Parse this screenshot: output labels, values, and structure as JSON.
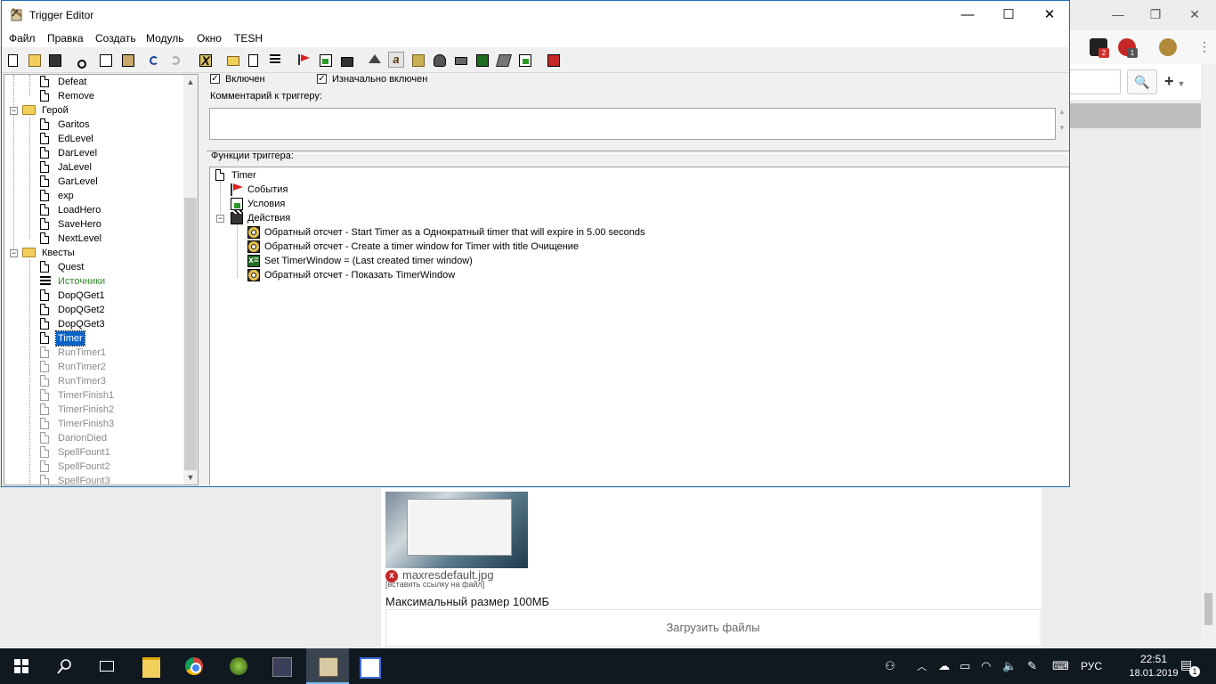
{
  "window": {
    "title": "Trigger Editor",
    "controls": {
      "minimize": "—",
      "maximize": "☐",
      "close": "✕"
    }
  },
  "menu": [
    "Файл",
    "Правка",
    "Создать",
    "Модуль",
    "Окно",
    "TESH"
  ],
  "toolbar": {
    "icons": [
      "new-icon",
      "open-icon",
      "save-icon",
      "cut-icon",
      "copy-icon",
      "paste-icon",
      "undo-icon",
      "redo-icon",
      "jass-icon",
      "new-category-icon",
      "new-trigger-icon",
      "new-comment-icon",
      "new-event-icon",
      "new-condition-icon",
      "new-action-icon",
      "terrain-editor-icon",
      "trigger-editor-icon",
      "sound-editor-icon",
      "object-editor-icon",
      "campaign-editor-icon",
      "ai-editor-icon",
      "object-manager-icon",
      "import-manager-icon",
      "test-map-icon"
    ]
  },
  "tree": {
    "items": [
      {
        "label": "Defeat",
        "type": "trigger",
        "level": 2,
        "state": "normal"
      },
      {
        "label": "Remove",
        "type": "trigger",
        "level": 2,
        "state": "normal"
      },
      {
        "label": "Герой",
        "type": "folder",
        "level": 1,
        "state": "normal"
      },
      {
        "label": "Garitos",
        "type": "trigger",
        "level": 2,
        "state": "normal"
      },
      {
        "label": "EdLevel",
        "type": "trigger",
        "level": 2,
        "state": "normal"
      },
      {
        "label": "DarLevel",
        "type": "trigger",
        "level": 2,
        "state": "normal"
      },
      {
        "label": "JaLevel",
        "type": "trigger",
        "level": 2,
        "state": "normal"
      },
      {
        "label": "GarLevel",
        "type": "trigger",
        "level": 2,
        "state": "normal"
      },
      {
        "label": "exp",
        "type": "trigger",
        "level": 2,
        "state": "normal"
      },
      {
        "label": "LoadHero",
        "type": "trigger",
        "level": 2,
        "state": "normal"
      },
      {
        "label": "SaveHero",
        "type": "trigger",
        "level": 2,
        "state": "normal"
      },
      {
        "label": "NextLevel",
        "type": "trigger",
        "level": 2,
        "state": "normal"
      },
      {
        "label": "Квесты",
        "type": "folder",
        "level": 1,
        "state": "normal"
      },
      {
        "label": "Quest",
        "type": "trigger",
        "level": 2,
        "state": "normal"
      },
      {
        "label": "Источники",
        "type": "variable",
        "level": 2,
        "state": "green"
      },
      {
        "label": "DopQGet1",
        "type": "trigger",
        "level": 2,
        "state": "normal"
      },
      {
        "label": "DopQGet2",
        "type": "trigger",
        "level": 2,
        "state": "normal"
      },
      {
        "label": "DopQGet3",
        "type": "trigger",
        "level": 2,
        "state": "normal"
      },
      {
        "label": "Timer",
        "type": "trigger",
        "level": 2,
        "state": "selected"
      },
      {
        "label": "RunTimer1",
        "type": "trigger",
        "level": 2,
        "state": "disabled"
      },
      {
        "label": "RunTimer2",
        "type": "trigger",
        "level": 2,
        "state": "disabled"
      },
      {
        "label": "RunTimer3",
        "type": "trigger",
        "level": 2,
        "state": "disabled"
      },
      {
        "label": "TimerFinish1",
        "type": "trigger",
        "level": 2,
        "state": "disabled"
      },
      {
        "label": "TimerFinish2",
        "type": "trigger",
        "level": 2,
        "state": "disabled"
      },
      {
        "label": "TimerFinish3",
        "type": "trigger",
        "level": 2,
        "state": "disabled"
      },
      {
        "label": "DarionDied",
        "type": "trigger",
        "level": 2,
        "state": "disabled"
      },
      {
        "label": "SpellFount1",
        "type": "trigger",
        "level": 2,
        "state": "disabled"
      },
      {
        "label": "SpellFount2",
        "type": "trigger",
        "level": 2,
        "state": "disabled"
      },
      {
        "label": "SpellFount3",
        "type": "trigger",
        "level": 2,
        "state": "disabled"
      }
    ]
  },
  "trigger": {
    "enabled_label": "Включен",
    "enabled": true,
    "initially_on_label": "Изначально включен",
    "initially_on": true,
    "comment_label": "Комментарий к триггеру:",
    "comment_value": "",
    "functions_label": "Функции триггера:",
    "root": "Timer",
    "events_label": "События",
    "conditions_label": "Условия",
    "actions_label": "Действия",
    "actions": [
      {
        "icon": "timer-icon",
        "text": "Обратный отсчет - Start Timer as a Однократный timer that will expire in 5.00 seconds"
      },
      {
        "icon": "timer-icon",
        "text": "Обратный отсчет - Create a timer window for Timer with title Очищение"
      },
      {
        "icon": "set-variable-icon",
        "text": "Set TimerWindow = (Last created timer window)"
      },
      {
        "icon": "timer-icon",
        "text": "Обратный отсчет - Показать TimerWindow"
      }
    ]
  },
  "browser": {
    "controls": {
      "minimize": "—",
      "restore": "❐",
      "close": "✕"
    },
    "ext_badges": [
      "2",
      "1"
    ],
    "search_icon": "🔍",
    "add_icon": "+",
    "file_name": "maxresdefault.jpg",
    "file_link": "[вставить ссылку на файл]",
    "max_size": "Максимальный размер 100МБ",
    "upload_label": "Загрузить файлы"
  },
  "taskbar": {
    "lang": "РУС",
    "time": "22:51",
    "date": "18.01.2019",
    "notifications": "1"
  }
}
